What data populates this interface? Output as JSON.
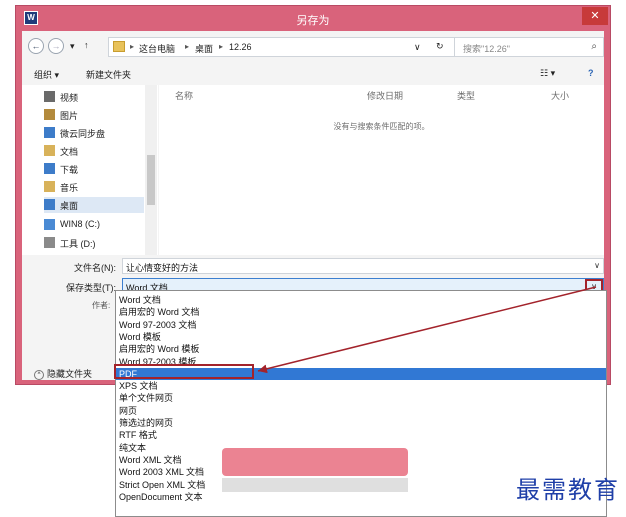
{
  "window": {
    "title": "另存为",
    "app_icon_glyph": "W",
    "close_glyph": "✕"
  },
  "address": {
    "back_glyph": "←",
    "forward_glyph": "→",
    "recent_glyph": "▾",
    "up_glyph": "↑",
    "breadcrumb": [
      "这台电脑",
      "桌面",
      "12.26"
    ],
    "sep": "▸",
    "dropdown_glyph": "∨",
    "refresh_glyph": "↻",
    "search_placeholder": "搜索\"12.26\"",
    "search_glyph": "⌕"
  },
  "toolbar": {
    "organize": "组织 ▾",
    "new_folder": "新建文件夹",
    "view_glyph": "☷ ▾",
    "help_glyph": "?"
  },
  "nav": {
    "items": [
      {
        "label": "视频",
        "icon": "video-icon",
        "color": "#6a6a6a"
      },
      {
        "label": "图片",
        "icon": "picture-icon",
        "color": "#b38a3c"
      },
      {
        "label": "微云同步盘",
        "icon": "cloud-icon",
        "color": "#3d7cc9"
      },
      {
        "label": "文档",
        "icon": "document-icon",
        "color": "#d8b25a"
      },
      {
        "label": "下载",
        "icon": "download-icon",
        "color": "#3d7cc9"
      },
      {
        "label": "音乐",
        "icon": "music-icon",
        "color": "#d8b25a"
      },
      {
        "label": "桌面",
        "icon": "desktop-icon",
        "color": "#3d7cc9"
      },
      {
        "label": "WIN8 (C:)",
        "icon": "drive-c-icon",
        "color": "#4a8ad4"
      },
      {
        "label": "工具 (D:)",
        "icon": "drive-d-icon",
        "color": "#8a8a8a"
      }
    ]
  },
  "files": {
    "columns": [
      "名称",
      "修改日期",
      "类型",
      "大小"
    ],
    "empty_message": "没有与搜索条件匹配的项。"
  },
  "form": {
    "filename_label": "文件名(N):",
    "filename_value": "让心情变好的方法",
    "type_label": "保存类型(T):",
    "type_value": "Word 文档",
    "arrow_glyph": "∨",
    "author_label": "作者:",
    "hide_folders": "隐藏文件夹",
    "hide_glyph": "^"
  },
  "dropdown": {
    "options": [
      "Word 文档",
      "启用宏的 Word 文档",
      "Word 97-2003 文档",
      "Word 模板",
      "启用宏的 Word 模板",
      "Word 97-2003 模板",
      "PDF",
      "XPS 文档",
      "单个文件网页",
      "网页",
      "筛选过的网页",
      "RTF 格式",
      "纯文本",
      "Word XML 文档",
      "Word 2003 XML 文档",
      "Strict Open XML 文档",
      "OpenDocument 文本"
    ],
    "selected_index": 6
  },
  "watermark": "最需教育",
  "accent": {
    "titlebar": "#d9637b",
    "annotation": "#a3232b",
    "selection": "#3178d4"
  }
}
